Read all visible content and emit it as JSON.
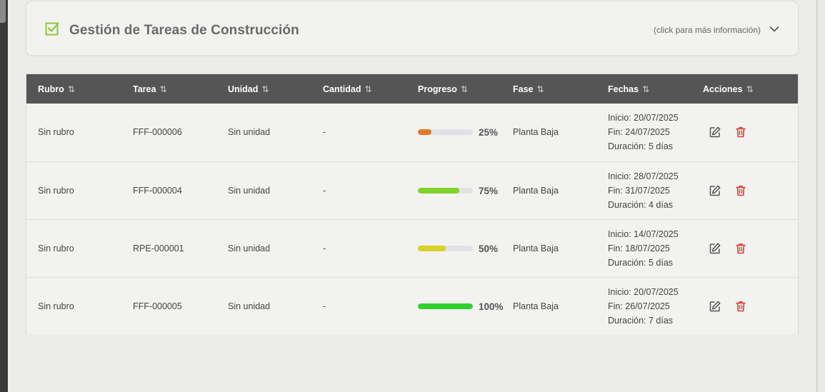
{
  "header": {
    "title": "Gestión de Tareas de Construcción",
    "hint": "(click para más información)"
  },
  "icons": {
    "check": "checkbox-icon",
    "chevron": "chevron-down-icon",
    "sort": "sort-arrows-icon",
    "edit": "edit-icon",
    "delete": "trash-icon"
  },
  "colors": {
    "header_bg": "#555555",
    "accent_green": "#8cc63f",
    "delete_red": "#e03a3a"
  },
  "table": {
    "columns": [
      "Rubro",
      "Tarea",
      "Unidad",
      "Cantidad",
      "Progreso",
      "Fase",
      "Fechas",
      "Acciones"
    ],
    "sort_glyph": "⇅",
    "rows": [
      {
        "rubro": "Sin rubro",
        "tarea": "FFF-000006",
        "unidad": "Sin unidad",
        "cantidad": "-",
        "progress": 25,
        "progress_label": "25%",
        "progress_color": "#e07b2a",
        "fase": "Planta Baja",
        "inicio": "Inicio: 20/07/2025",
        "fin": "Fin: 24/07/2025",
        "duracion": "Duración: 5 días"
      },
      {
        "rubro": "Sin rubro",
        "tarea": "FFF-000004",
        "unidad": "Sin unidad",
        "cantidad": "-",
        "progress": 75,
        "progress_label": "75%",
        "progress_color": "#7fd42a",
        "fase": "Planta Baja",
        "inicio": "Inicio: 28/07/2025",
        "fin": "Fin: 31/07/2025",
        "duracion": "Duración: 4 días"
      },
      {
        "rubro": "Sin rubro",
        "tarea": "RPE-000001",
        "unidad": "Sin unidad",
        "cantidad": "-",
        "progress": 50,
        "progress_label": "50%",
        "progress_color": "#d9d22a",
        "fase": "Planta Baja",
        "inicio": "Inicio: 14/07/2025",
        "fin": "Fin: 18/07/2025",
        "duracion": "Duración: 5 días"
      },
      {
        "rubro": "Sin rubro",
        "tarea": "FFF-000005",
        "unidad": "Sin unidad",
        "cantidad": "-",
        "progress": 100,
        "progress_label": "100%",
        "progress_color": "#2fd12f",
        "fase": "Planta Baja",
        "inicio": "Inicio: 20/07/2025",
        "fin": "Fin: 26/07/2025",
        "duracion": "Duración: 7 días"
      }
    ]
  }
}
